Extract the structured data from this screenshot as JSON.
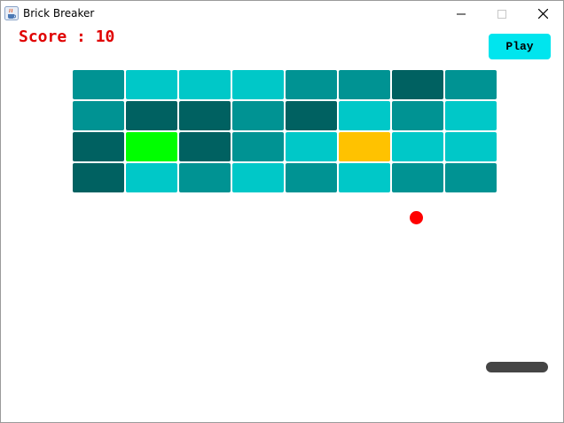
{
  "window": {
    "title": "Brick Breaker",
    "app_icon": "java-cup-icon",
    "controls": [
      "minimize-icon",
      "maximize-icon",
      "close-icon"
    ]
  },
  "hud": {
    "score_text": "Score : 10",
    "play_label": "Play"
  },
  "colors": {
    "score_text": "#e00000",
    "play_button": "#00e5ee",
    "ball": "#ff0000",
    "paddle": "#454545",
    "brick_light": "#00c8c8",
    "brick_mid": "#009393",
    "brick_dark": "#006161",
    "brick_green": "#00ff00",
    "brick_yellow": "#ffc200"
  },
  "bricks": {
    "columns": 8,
    "rows": 4,
    "layout": [
      [
        "brick_mid",
        "brick_light",
        "brick_light",
        "brick_light",
        "brick_mid",
        "brick_mid",
        "brick_dark",
        "brick_mid"
      ],
      [
        "brick_mid",
        "brick_dark",
        "brick_dark",
        "brick_mid",
        "brick_dark",
        "brick_light",
        "brick_mid",
        "brick_light"
      ],
      [
        "brick_dark",
        "brick_green",
        "brick_dark",
        "brick_mid",
        "brick_light",
        "brick_yellow",
        "brick_light",
        "brick_light"
      ],
      [
        "brick_dark",
        "brick_light",
        "brick_mid",
        "brick_light",
        "brick_mid",
        "brick_light",
        "brick_mid",
        "brick_mid"
      ]
    ]
  }
}
